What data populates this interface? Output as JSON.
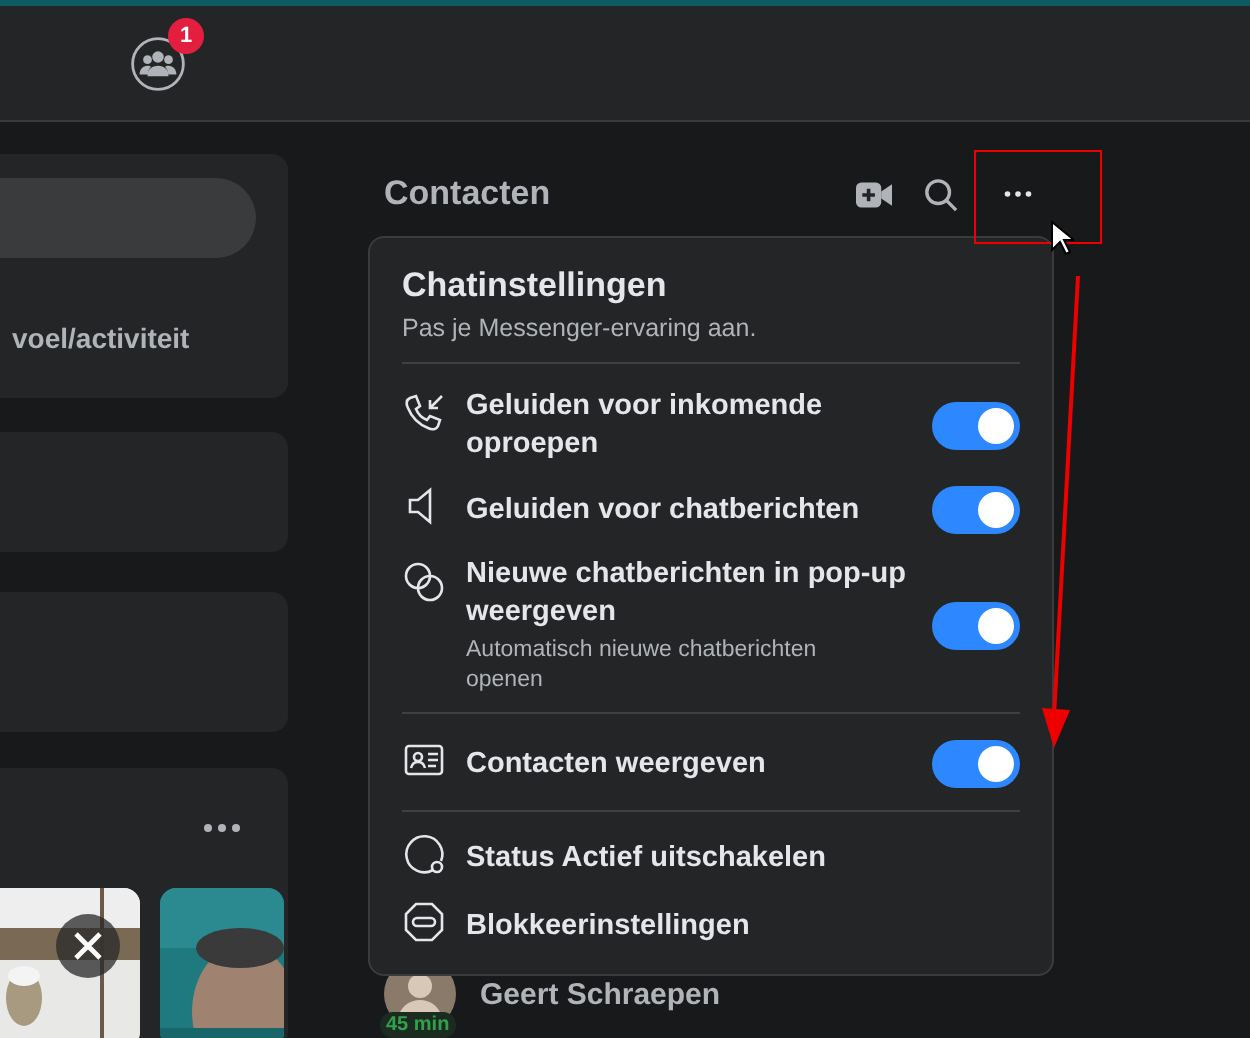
{
  "topbar": {
    "groups_badge": "1"
  },
  "left": {
    "feeling_label": "voel/activiteit"
  },
  "contacts": {
    "title": "Contacten",
    "people": [
      {
        "name": "Geert Schraepen",
        "active_time": "45 min"
      }
    ]
  },
  "menu": {
    "title": "Chatinstellingen",
    "subtitle": "Pas je Messenger-ervaring aan.",
    "sections": [
      [
        {
          "kind": "toggle",
          "label": "Geluiden voor inkomende oproepen",
          "on": true
        },
        {
          "kind": "toggle",
          "label": "Geluiden voor chatberichten",
          "on": true
        },
        {
          "kind": "toggle",
          "label": "Nieuwe chatberichten in pop-up weergeven",
          "sublabel": "Automatisch nieuwe chatberichten openen",
          "on": true
        }
      ],
      [
        {
          "kind": "toggle",
          "label": "Contacten weergeven",
          "on": true
        }
      ],
      [
        {
          "kind": "link",
          "label": "Status Actief uitschakelen"
        },
        {
          "kind": "link",
          "label": "Blokkeerinstellingen"
        }
      ]
    ]
  }
}
